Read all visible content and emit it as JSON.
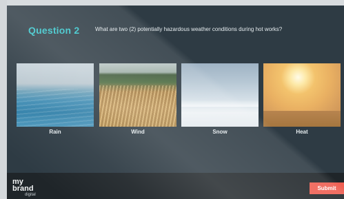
{
  "question": {
    "label": "Question 2",
    "text": "What are two (2) potentially hazardous weather conditions during hot works?"
  },
  "options": [
    {
      "label": "Rain"
    },
    {
      "label": "Wind"
    },
    {
      "label": "Snow"
    },
    {
      "label": "Heat"
    }
  ],
  "brand": {
    "line1": "my",
    "line2": "brand",
    "line3": "digital"
  },
  "actions": {
    "submit_label": "Submit"
  },
  "colors": {
    "accent": "#35c3c9",
    "submit": "#ee5e51",
    "background": "#2e3b44",
    "footer": "#1f2529"
  }
}
